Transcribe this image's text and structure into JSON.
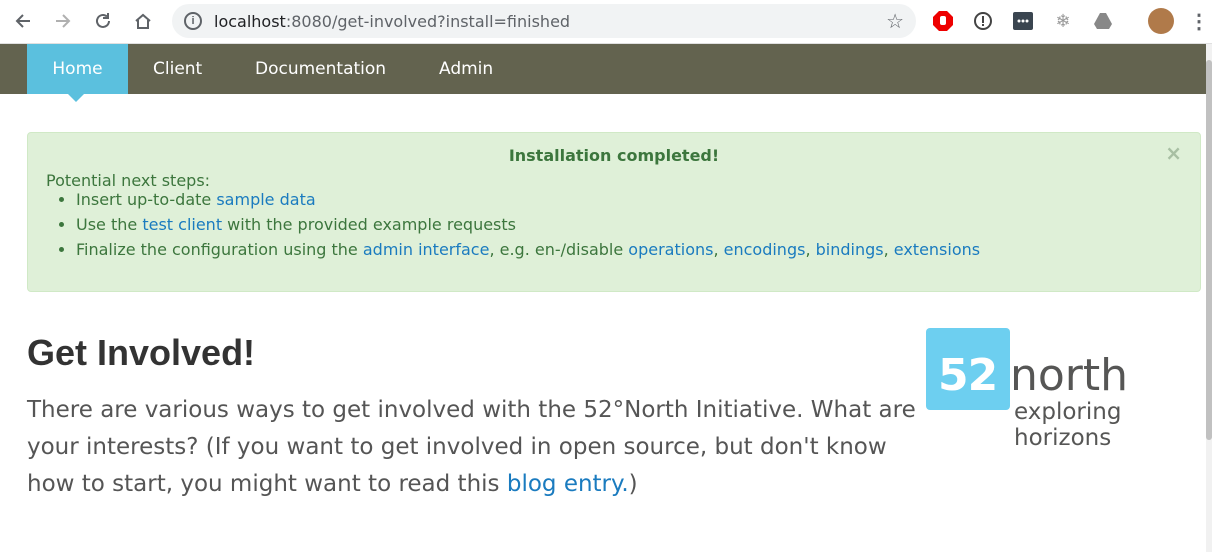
{
  "browser": {
    "url_host": "localhost",
    "url_rest": ":8080/get-involved?install=finished"
  },
  "nav": {
    "items": [
      "Home",
      "Client",
      "Documentation",
      "Admin"
    ]
  },
  "alert": {
    "title": "Installation completed!",
    "close_label": "×",
    "lead": "Potential next steps:",
    "step1_text": "Insert up-to-date ",
    "step1_link": "sample data",
    "step2_pre": "Use the ",
    "step2_link": "test client",
    "step2_post": " with the provided example requests",
    "step3_pre": "Finalize the configuration using the ",
    "step3_link1": "admin interface",
    "step3_mid": ", e.g. en-/disable ",
    "step3_link2": "operations",
    "sep1": ", ",
    "step3_link3": "encodings",
    "sep2": ", ",
    "step3_link4": "bindings",
    "sep3": ", ",
    "step3_link5": "extensions"
  },
  "content": {
    "heading": "Get Involved!",
    "lead_text": "There are various ways to get involved with the 52°North Initiative. What are your interests? (If you want to get involved in open source, but don't know how to start, you might want to read this ",
    "lead_link": "blog entry.",
    "lead_end": ")"
  },
  "logo": {
    "digits": "52",
    "word": "north",
    "tagline": "exploring horizons"
  },
  "colors": {
    "nav_bg": "#63634f",
    "nav_active": "#5bc0de",
    "alert_bg": "#dff0d8",
    "alert_text": "#3c763d",
    "link": "#1a7bbf"
  }
}
